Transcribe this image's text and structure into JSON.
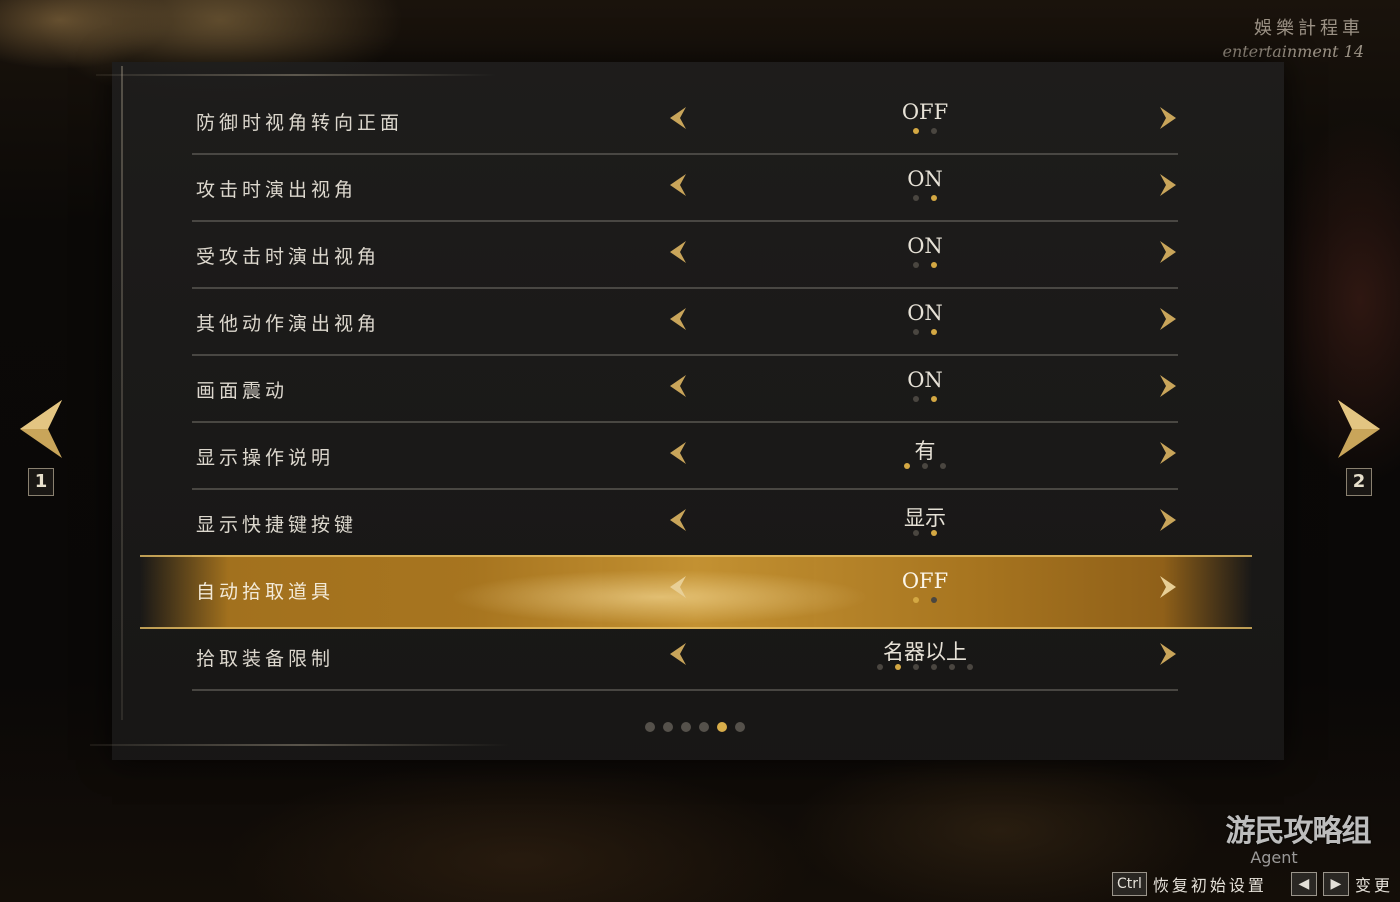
{
  "watermark": {
    "cn": "娛樂計程車",
    "en": "entertainment 14"
  },
  "settings": [
    {
      "label": "防御时视角转向正面",
      "value": "OFF",
      "options_count": 2,
      "selected_index": 0,
      "selected": false
    },
    {
      "label": "攻击时演出视角",
      "value": "ON",
      "options_count": 2,
      "selected_index": 1,
      "selected": false
    },
    {
      "label": "受攻击时演出视角",
      "value": "ON",
      "options_count": 2,
      "selected_index": 1,
      "selected": false
    },
    {
      "label": "其他动作演出视角",
      "value": "ON",
      "options_count": 2,
      "selected_index": 1,
      "selected": false
    },
    {
      "label": "画面震动",
      "value": "ON",
      "options_count": 2,
      "selected_index": 1,
      "selected": false
    },
    {
      "label": "显示操作说明",
      "value": "有",
      "options_count": 3,
      "selected_index": 0,
      "selected": false
    },
    {
      "label": "显示快捷键按键",
      "value": "显示",
      "options_count": 2,
      "selected_index": 1,
      "selected": false
    },
    {
      "label": "自动拾取道具",
      "value": "OFF",
      "options_count": 2,
      "selected_index": 0,
      "selected": true
    },
    {
      "label": "拾取装备限制",
      "value": "名器以上",
      "options_count": 6,
      "selected_index": 1,
      "selected": false
    }
  ],
  "pager": {
    "pages": 6,
    "current_index": 4
  },
  "nav": {
    "prev_key": "1",
    "next_key": "2"
  },
  "agent_logo": {
    "big": "游民攻略组",
    "small": "Agent"
  },
  "footer": {
    "reset_key": "Ctrl",
    "reset_label": "恢复初始设置",
    "change_label": "变更",
    "left_key": "◀",
    "right_key": "▶"
  },
  "colors": {
    "accent_gold": "#d4a843",
    "highlight_bar": "#b07a20",
    "text_main": "#dcd7cd"
  }
}
